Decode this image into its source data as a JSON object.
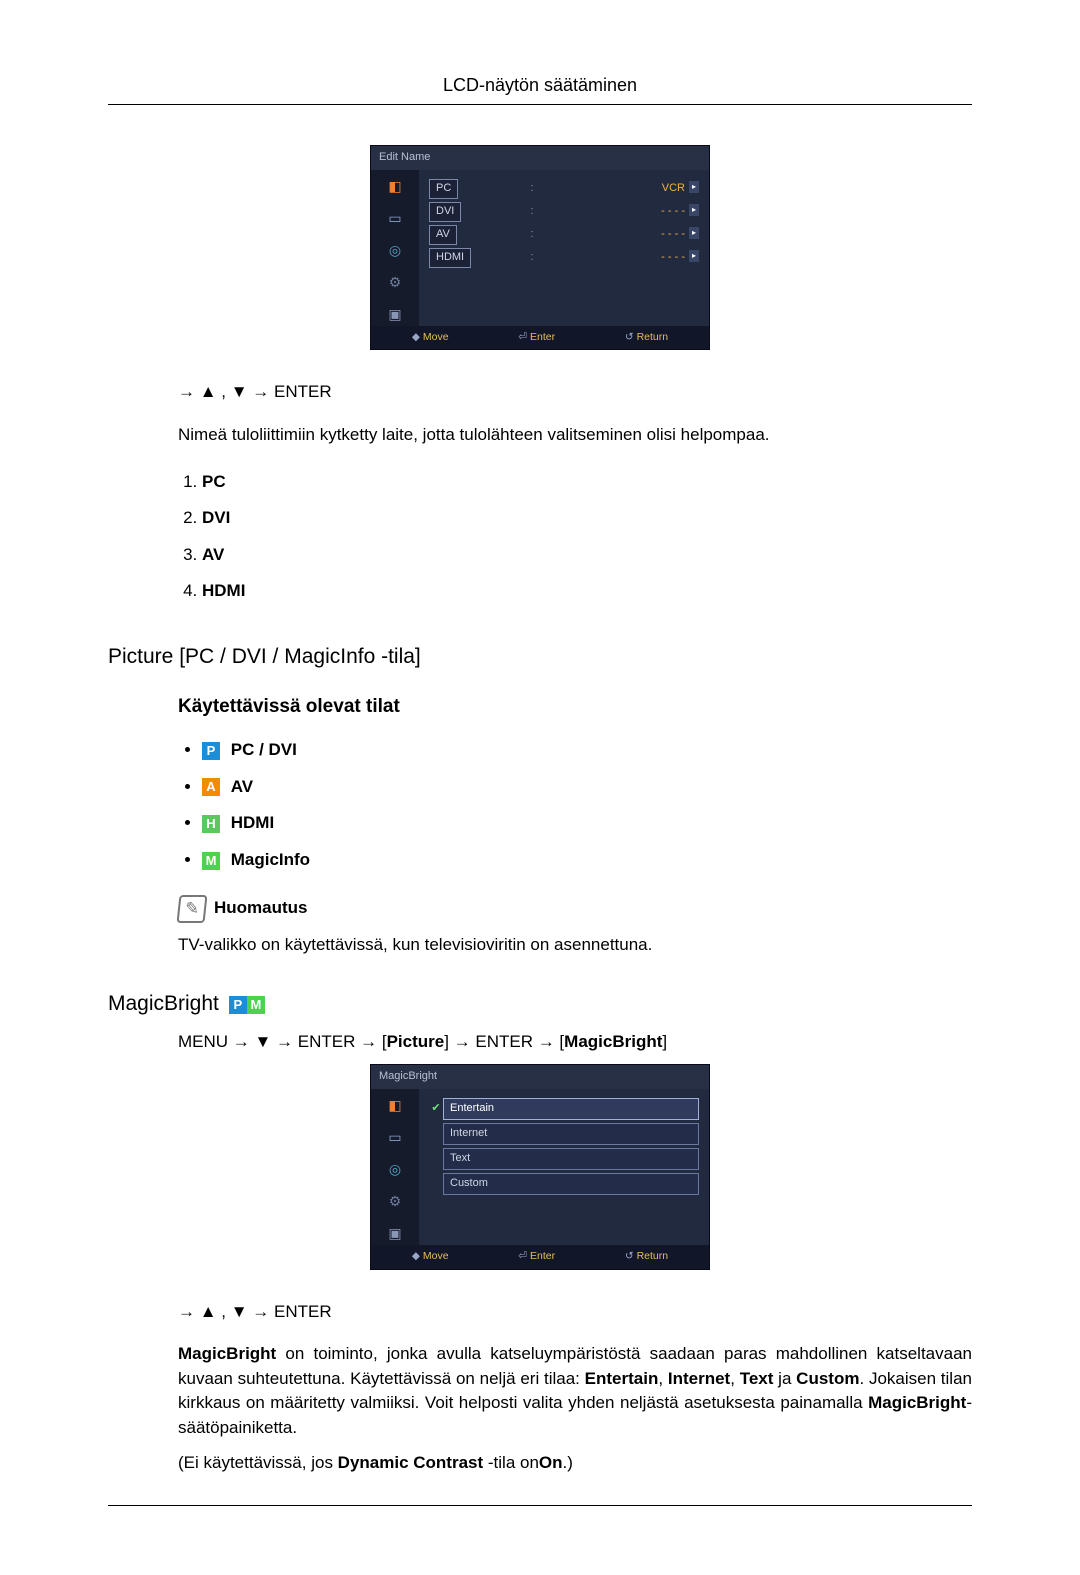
{
  "page_title": "LCD-näytön säätäminen",
  "osd1": {
    "title": "Edit Name",
    "rows": [
      {
        "label": "PC",
        "value": "VCR"
      },
      {
        "label": "DVI",
        "value": "- - - -"
      },
      {
        "label": "AV",
        "value": "- - - -"
      },
      {
        "label": "HDMI",
        "value": "- - - -"
      }
    ],
    "footer_move": "Move",
    "footer_enter": "Enter",
    "footer_return": "Return"
  },
  "nav1": "→ ▲ , ▼ → ENTER",
  "intro1": "Nimeä tuloliittimiin kytketty laite, jotta tulolähteen valitseminen olisi helpompaa.",
  "ol_items": [
    "PC",
    "DVI",
    "AV",
    "HDMI"
  ],
  "h2_picture": "Picture [PC / DVI / MagicInfo -tila]",
  "h3_modes": "Käytettävissä olevat tilat",
  "modes": {
    "p": "PC / DVI",
    "a": "AV",
    "h": "HDMI",
    "m": "MagicInfo"
  },
  "note_label": "Huomautus",
  "note_text": "TV-valikko on käytettävissä, kun televisioviritin on asennettuna.",
  "h2_magicbright": "MagicBright",
  "menu_path": {
    "t1": "MENU → ▼ → ENTER → [",
    "b1": "Picture",
    "t2": "] → ENTER → [",
    "b2": "MagicBright",
    "t3": "]"
  },
  "osd2": {
    "title": "MagicBright",
    "options": [
      "Entertain",
      "Internet",
      "Text",
      "Custom"
    ],
    "selected_index": 0,
    "footer_move": "Move",
    "footer_enter": "Enter",
    "footer_return": "Return"
  },
  "nav2": "→ ▲ , ▼ → ENTER",
  "mb_para": {
    "b1": "MagicBright",
    "t1": " on toiminto, jonka avulla katseluympäristöstä saadaan paras mahdollinen katseltavaan kuvaan suhteutettuna. Käytettävissä on neljä eri tilaa: ",
    "b2": "Entertain",
    "t2": ", ",
    "b3": "Internet",
    "t3": ", ",
    "b4": "Text",
    "t4": " ja ",
    "b5": "Custom",
    "t5": ". Jokaisen tilan kirkkaus on määritetty valmiiksi. Voit helposti valita yhden neljästä asetuksesta painamalla ",
    "b6": "MagicBright",
    "t6": "-säätöpainiketta."
  },
  "mb_para2": {
    "t1": "(Ei käytettävissä, jos ",
    "b1": "Dynamic Contrast",
    "t2": " -tila on",
    "b2": "On",
    "t3": ".)"
  }
}
